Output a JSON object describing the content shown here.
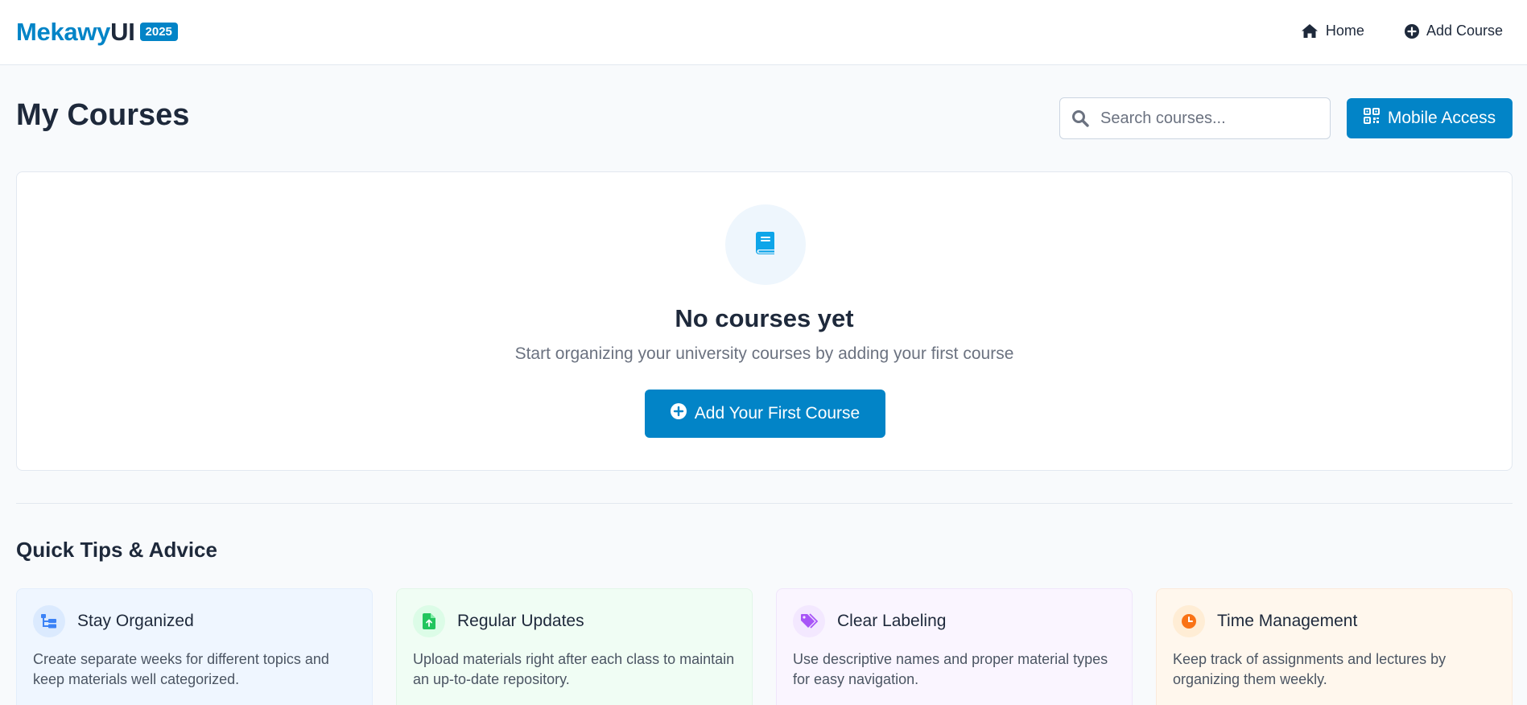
{
  "header": {
    "brand_main": "Mekawy",
    "brand_suffix": "UI",
    "brand_badge": "2025",
    "nav": [
      {
        "label": "Home",
        "icon": "home-icon"
      },
      {
        "label": "Add Course",
        "icon": "plus-circle-icon"
      }
    ]
  },
  "page": {
    "title": "My Courses",
    "search_placeholder": "Search courses...",
    "mobile_access_label": "Mobile Access"
  },
  "empty_state": {
    "icon": "book-icon",
    "title": "No courses yet",
    "subtitle": "Start organizing your university courses by adding your first course",
    "button_label": "Add Your First Course"
  },
  "tips": {
    "title": "Quick Tips & Advice",
    "items": [
      {
        "title": "Stay Organized",
        "text": "Create separate weeks for different topics and keep materials well categorized.",
        "icon": "folder-tree-icon",
        "color": "#3b82f6"
      },
      {
        "title": "Regular Updates",
        "text": "Upload materials right after each class to maintain an up-to-date repository.",
        "icon": "file-upload-icon",
        "color": "#22c55e"
      },
      {
        "title": "Clear Labeling",
        "text": "Use descriptive names and proper material types for easy navigation.",
        "icon": "tags-icon",
        "color": "#a855f7"
      },
      {
        "title": "Time Management",
        "text": "Keep track of assignments and lectures by organizing them weekly.",
        "icon": "clock-icon",
        "color": "#f97316"
      }
    ]
  },
  "colors": {
    "accent": "#0284c7",
    "text": "#1e293b",
    "muted": "#6b7280"
  }
}
